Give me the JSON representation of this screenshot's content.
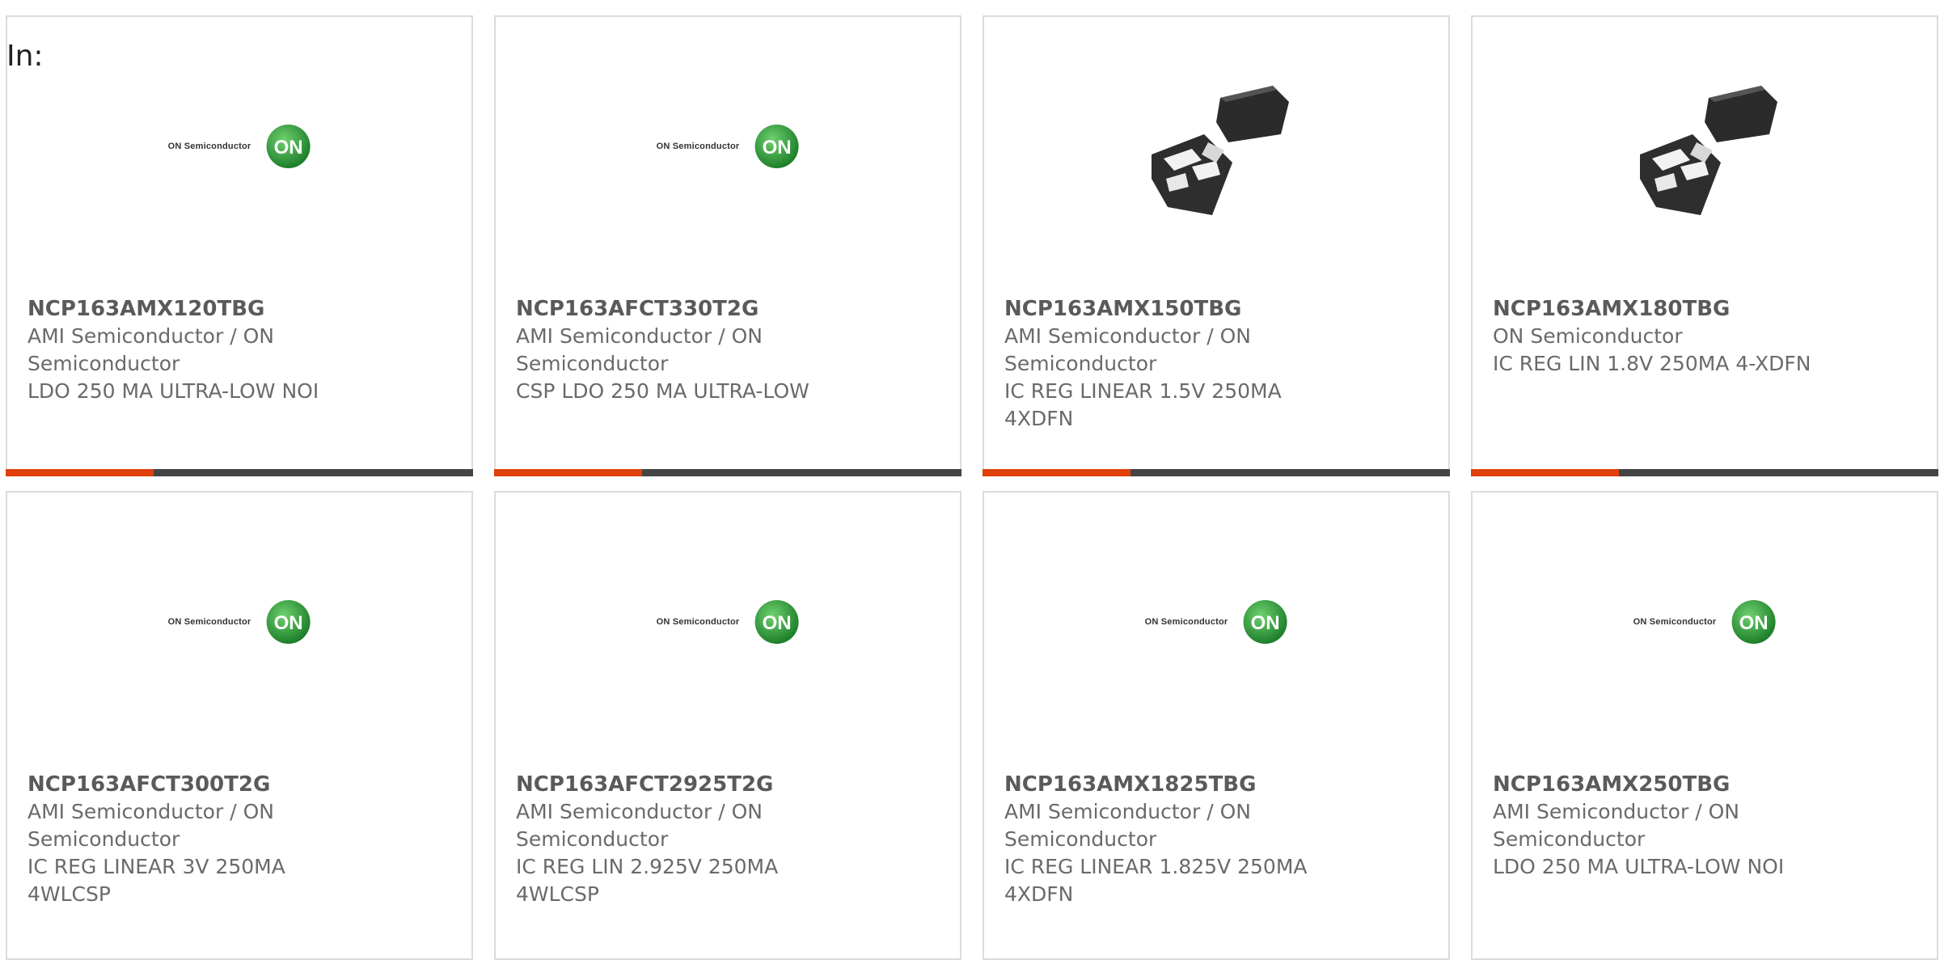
{
  "header": {
    "label": "In:"
  },
  "logo": {
    "text": "ON Semiconductor",
    "badge": "ON"
  },
  "colors": {
    "accent": "#e0400c",
    "bar": "#444444",
    "border": "#dcdcdc",
    "badge": "#2e9a3a"
  },
  "products": [
    {
      "part": "NCP163AMX120TBG",
      "mfr1": "AMI Semiconductor / ON",
      "mfr2": "Semiconductor",
      "d1": "LDO 250 MA ULTRA-LOW NOI",
      "d2": "",
      "image": "on-semi-logo"
    },
    {
      "part": "NCP163AFCT330T2G",
      "mfr1": "AMI Semiconductor / ON",
      "mfr2": "Semiconductor",
      "d1": "CSP LDO 250 MA ULTRA-LOW",
      "d2": "",
      "image": "on-semi-logo"
    },
    {
      "part": "NCP163AMX150TBG",
      "mfr1": "AMI Semiconductor / ON",
      "mfr2": "Semiconductor",
      "d1": "IC REG LINEAR 1.5V 250MA",
      "d2": "4XDFN",
      "image": "xdfn-chip"
    },
    {
      "part": "NCP163AMX180TBG",
      "mfr1": "ON Semiconductor",
      "mfr2": "IC REG LIN 1.8V 250MA 4-XDFN",
      "d1": "",
      "d2": "",
      "image": "xdfn-chip"
    },
    {
      "part": "NCP163AFCT300T2G",
      "mfr1": "AMI Semiconductor / ON",
      "mfr2": "Semiconductor",
      "d1": "IC REG LINEAR 3V 250MA",
      "d2": "4WLCSP",
      "image": "on-semi-logo"
    },
    {
      "part": "NCP163AFCT2925T2G",
      "mfr1": "AMI Semiconductor / ON",
      "mfr2": "Semiconductor",
      "d1": "IC REG LIN 2.925V 250MA",
      "d2": "4WLCSP",
      "image": "on-semi-logo"
    },
    {
      "part": "NCP163AMX1825TBG",
      "mfr1": "AMI Semiconductor / ON",
      "mfr2": "Semiconductor",
      "d1": "IC REG LINEAR 1.825V 250MA",
      "d2": "4XDFN",
      "image": "on-semi-logo"
    },
    {
      "part": "NCP163AMX250TBG",
      "mfr1": "AMI Semiconductor / ON",
      "mfr2": "Semiconductor",
      "d1": "LDO 250 MA ULTRA-LOW NOI",
      "d2": "",
      "image": "on-semi-logo"
    }
  ]
}
